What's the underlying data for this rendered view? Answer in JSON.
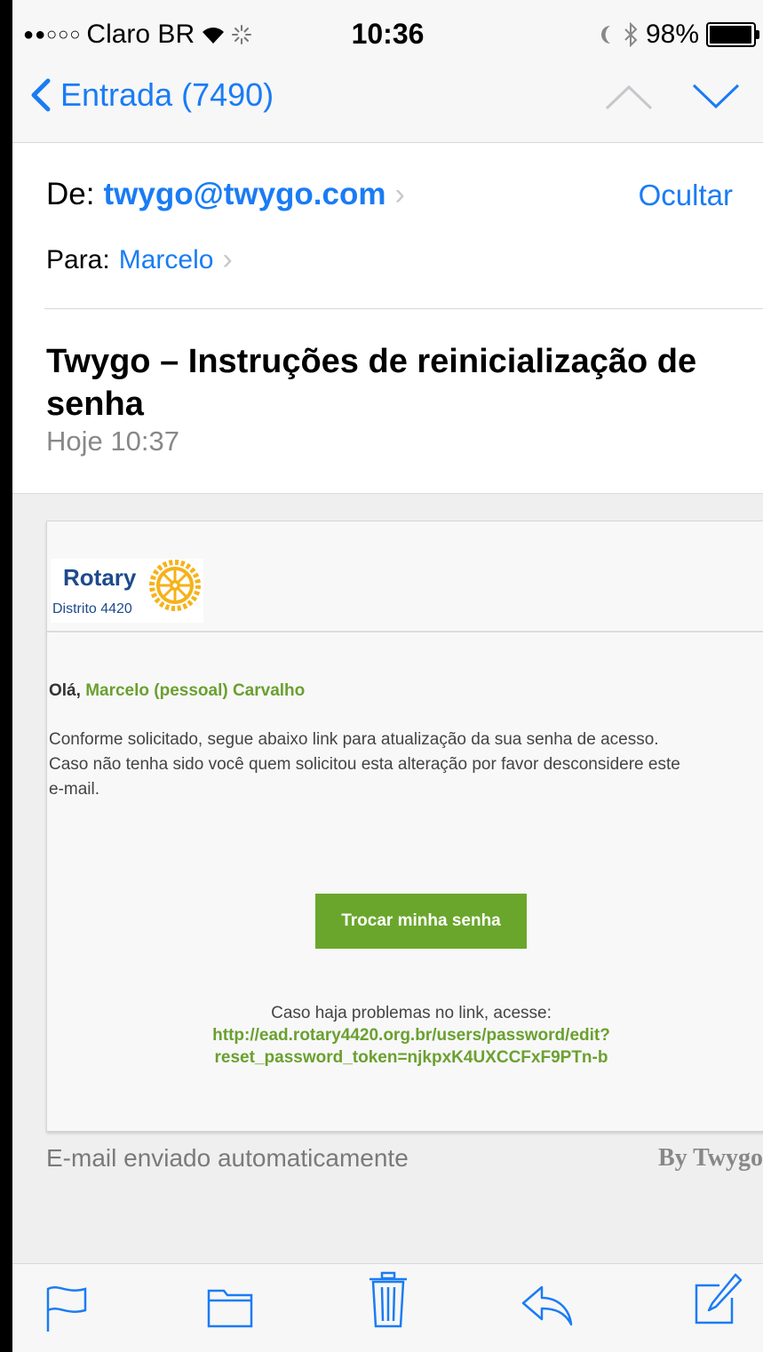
{
  "status_bar": {
    "signal_dots": "●●○○○",
    "carrier": "Claro BR",
    "time": "10:36",
    "battery": "98%"
  },
  "nav": {
    "back_label": "Entrada (7490)"
  },
  "header": {
    "from_label": "De:",
    "from_address": "twygo@twygo.com",
    "hide_label": "Ocultar",
    "to_label": "Para:",
    "to_name": "Marcelo",
    "subject": "Twygo – Instruções de reinicialização de senha",
    "date": "Hoje 10:37"
  },
  "email": {
    "logo": {
      "brand": "Rotary",
      "district": "Distrito 4420"
    },
    "greeting_prefix": "Olá,",
    "greeting_name": "Marcelo (pessoal) Carvalho",
    "paragraph_line1": "Conforme solicitado, segue abaixo link para atualização da sua senha de acesso.",
    "paragraph_line2": "Caso não tenha sido você quem solicitou esta alteração por favor desconsidere este",
    "paragraph_line3": "e-mail.",
    "button_label": "Trocar minha senha",
    "help_text": "Caso haja problemas no link, acesse:",
    "link_line1": "http://ead.rotary4420.org.br/users/password/edit?",
    "link_line2": "reset_password_token=njkpxK4UXCCFxF9PTn-b",
    "footer_left": "E-mail enviado automaticamente",
    "footer_right": "By Twygo"
  },
  "colors": {
    "ios_blue": "#1a7cf4",
    "accent_green": "#6aa62c",
    "rotary_blue": "#1e4a8c",
    "rotary_gold": "#f5b21a"
  },
  "toolbar": {
    "icons": [
      "flag-icon",
      "folder-icon",
      "trash-icon",
      "reply-icon",
      "compose-icon"
    ]
  }
}
